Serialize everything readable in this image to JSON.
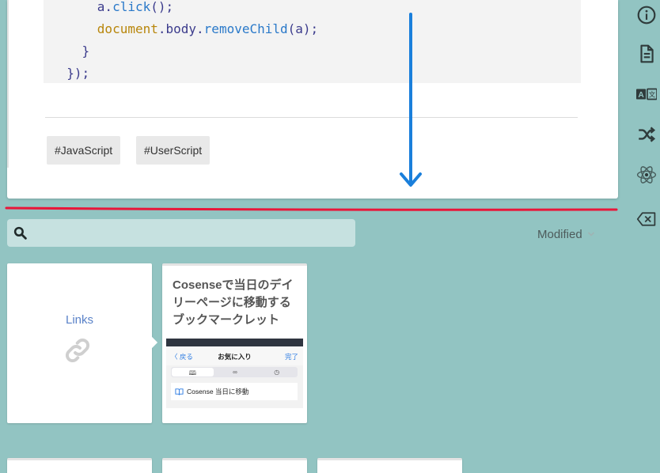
{
  "code": {
    "lines": [
      {
        "indent": "      ",
        "parts": [
          {
            "t": "a.",
            "c": "tok-id"
          },
          {
            "t": "click",
            "c": "tok-method"
          },
          {
            "t": "();",
            "c": "tok-id"
          }
        ]
      },
      {
        "indent": "      ",
        "parts": [
          {
            "t": "document",
            "c": "tok-obj"
          },
          {
            "t": ".",
            "c": "tok-id"
          },
          {
            "t": "body",
            "c": "tok-id"
          },
          {
            "t": ".",
            "c": "tok-id"
          },
          {
            "t": "removeChild",
            "c": "tok-method"
          },
          {
            "t": "(a);",
            "c": "tok-id"
          }
        ]
      },
      {
        "indent": "    ",
        "parts": [
          {
            "t": "}",
            "c": "tok-id"
          }
        ]
      },
      {
        "indent": "  ",
        "parts": [
          {
            "t": "});",
            "c": "tok-id"
          }
        ]
      }
    ]
  },
  "tags": [
    "#JavaScript",
    "#UserScript"
  ],
  "rail": {
    "icons": [
      "info-icon",
      "document-icon",
      "translate-icon",
      "shuffle-icon",
      "react-icon",
      "backspace-icon"
    ]
  },
  "search": {
    "placeholder": "",
    "value": ""
  },
  "sort": {
    "label": "Modified"
  },
  "links_card": {
    "label": "Links"
  },
  "page_card": {
    "title": "Cosenseで当日のデイリーページに移動するブックマークレット",
    "thumb": {
      "back": "〈 戻る",
      "title": "お気に入り",
      "done": "完了",
      "segments": [
        "M",
        "∞",
        "◷"
      ],
      "row": "Cosense 当日に移動"
    }
  },
  "colors": {
    "background": "#92c4c2",
    "annotation_red": "#e8173a",
    "annotation_blue": "#1a7fdb",
    "link_blue": "#5a82c8"
  }
}
